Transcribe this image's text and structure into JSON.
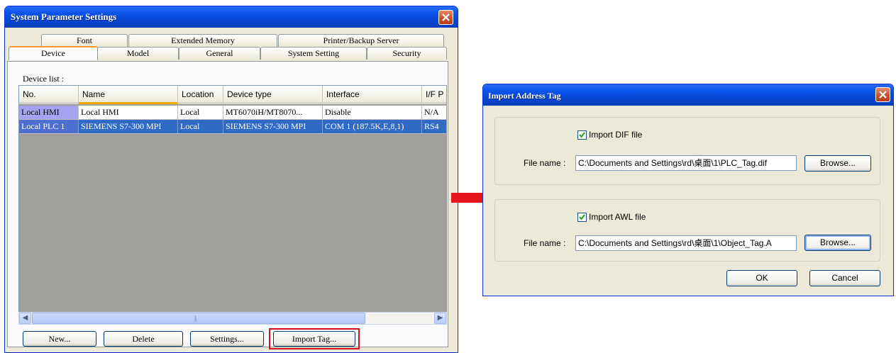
{
  "win1": {
    "title": "System Parameter Settings",
    "tabs_back": [
      "Font",
      "Extended Memory",
      "Printer/Backup Server"
    ],
    "tabs_front": [
      "Device",
      "Model",
      "General",
      "System Setting",
      "Security"
    ],
    "active_tab": "Device",
    "device_list_label": "Device list :",
    "columns": [
      "No.",
      "Name",
      "Location",
      "Device type",
      "Interface",
      "I/F P"
    ],
    "rows": [
      [
        "Local HMI",
        "Local HMI",
        "Local",
        "MT6070iH/MT8070...",
        "Disable",
        "N/A"
      ],
      [
        "Local PLC 1",
        "SIEMENS S7-300 MPI",
        "Local",
        "SIEMENS S7-300 MPI",
        "COM 1 (187.5K,E,8,1)",
        "RS4"
      ]
    ],
    "scroll_thumb_grip": "|||",
    "buttons": {
      "new": "New...",
      "delete": "Delete",
      "settings": "Settings...",
      "import_tag": "Import Tag..."
    }
  },
  "win2": {
    "title": "Import Address Tag",
    "dif": {
      "label": "Import DIF file",
      "checked": true,
      "file_label": "File name :",
      "file_value": "C:\\Documents and Settings\\rd\\桌面\\1\\PLC_Tag.dif",
      "browse": "Browse..."
    },
    "awl": {
      "label": "Import AWL file",
      "checked": true,
      "file_label": "File name :",
      "file_value": "C:\\Documents and Settings\\rd\\桌面\\1\\Object_Tag.A",
      "browse": "Browse..."
    },
    "ok": "OK",
    "cancel": "Cancel"
  },
  "colors": {
    "titlebar": "#0a54e8",
    "selection": "#316ac5",
    "arrow": "#e8141c",
    "highlight_box": "#d4141c"
  }
}
